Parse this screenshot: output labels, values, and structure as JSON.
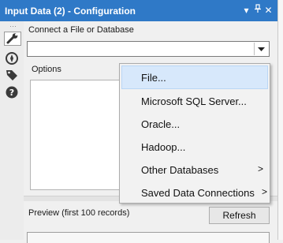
{
  "window": {
    "title": "Input Data (2) - Configuration",
    "controls": {
      "dropdown": "▾",
      "pin": "⊥",
      "close": "✕"
    }
  },
  "sidebar": {
    "icons": [
      "wrench-icon",
      "compass-icon",
      "tag-icon",
      "help-icon"
    ],
    "active": "wrench-icon"
  },
  "connect": {
    "label": "Connect a File or Database",
    "value": ""
  },
  "options": {
    "label": "Options"
  },
  "preview": {
    "label": "Preview (first 100 records)",
    "refresh_label": "Refresh"
  },
  "menu": {
    "items": [
      {
        "label": "File...",
        "submenu": false,
        "highlighted": true
      },
      {
        "label": "Microsoft SQL Server...",
        "submenu": false,
        "highlighted": false
      },
      {
        "label": "Oracle...",
        "submenu": false,
        "highlighted": false
      },
      {
        "label": "Hadoop...",
        "submenu": false,
        "highlighted": false
      },
      {
        "label": "Other Databases",
        "submenu": true,
        "submenu_glyph": ">",
        "highlighted": false
      },
      {
        "label": "Saved Data Connections",
        "submenu": true,
        "submenu_glyph": ">",
        "highlighted": false
      }
    ]
  },
  "colors": {
    "title_bar": "#2f79c7",
    "menu_highlight": "#d7e8fb",
    "sidebar_icon": "#3a3a3a"
  }
}
